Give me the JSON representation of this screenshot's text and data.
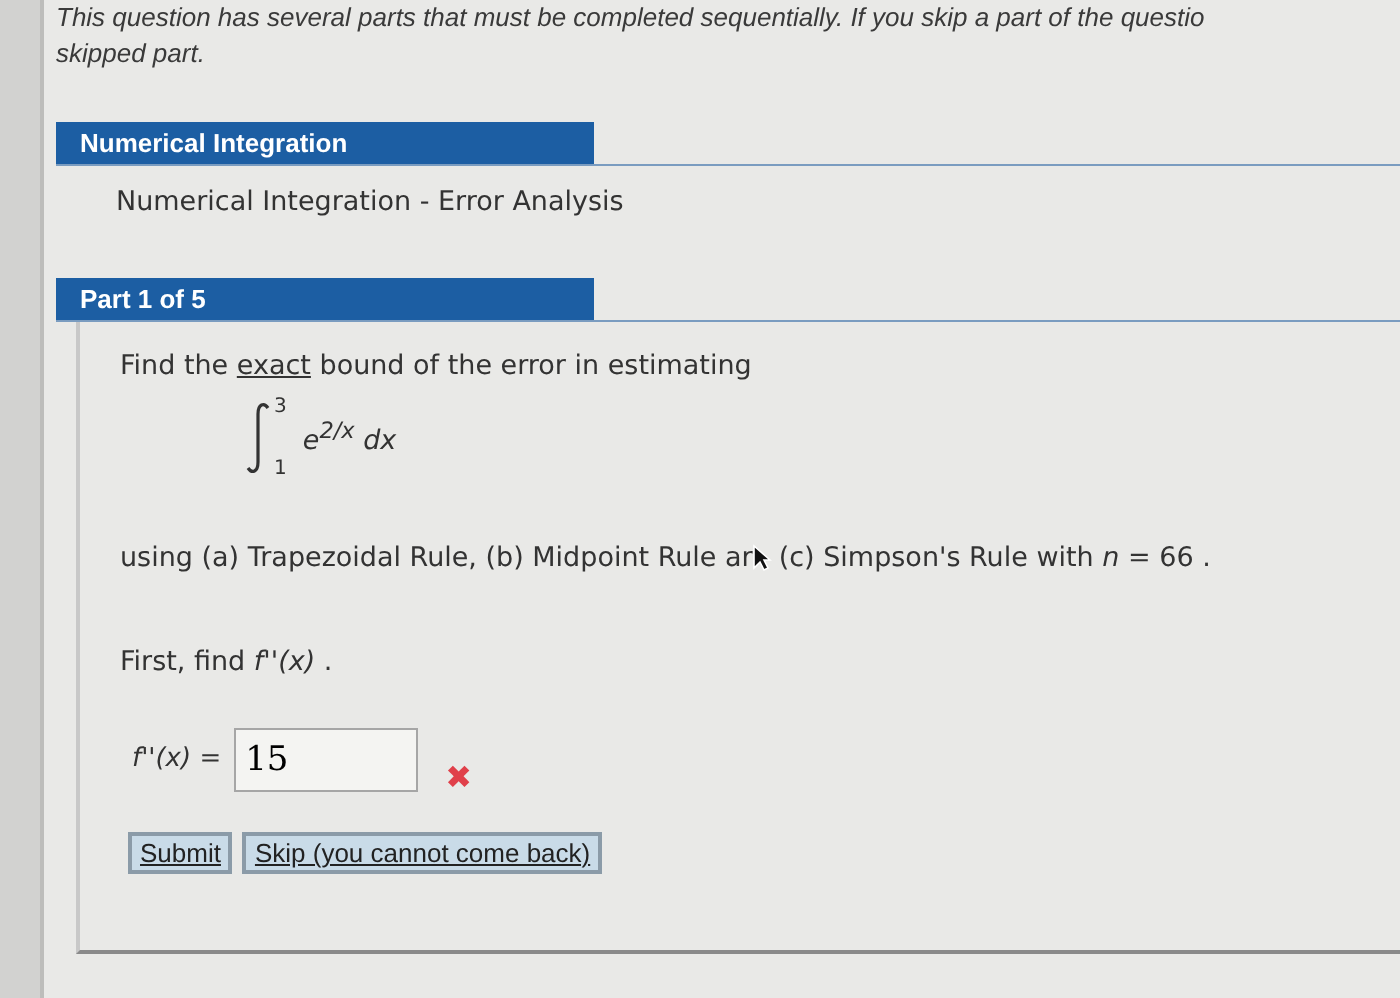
{
  "intro": [
    "This question has several parts that must be completed sequentially. If you skip a part of the questio",
    "skipped part."
  ],
  "section": {
    "title": "Numerical Integration",
    "subtitle": "Numerical Integration - Error Analysis"
  },
  "part": {
    "title": "Part 1 of 5",
    "prompt": {
      "before": "Find the",
      "underlined": "exact",
      "after": "bound of the error in estimating"
    },
    "integral": {
      "upper": "3",
      "lower": "1",
      "integrand": "e$^{2/x}$ dx"
    },
    "method": [
      "using (a) Trapezoidal Rule, (b) Midpoint Rule ar",
      "(c) Simpson's Rule with *n* = 66 ."
    ],
    "step": "First, find *f''(x)* .",
    "answer": {
      "label": "*f''(x)* =",
      "value": "15",
      "correct": false,
      "mark": "✖"
    },
    "buttons": [
      "Submit",
      "Skip (you cannot come back)"
    ]
  }
}
